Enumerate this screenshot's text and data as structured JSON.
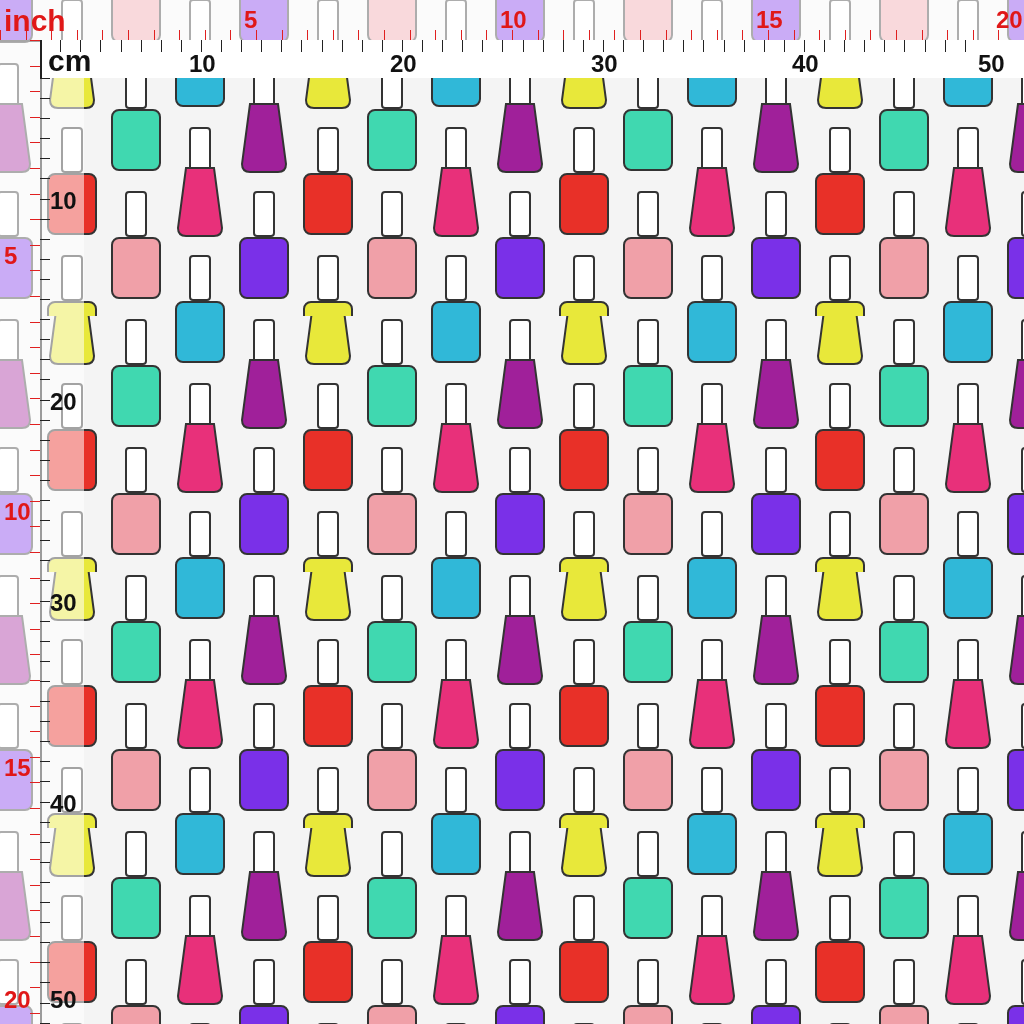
{
  "rulers": {
    "top_inch": {
      "unit": "inch",
      "labels": [
        "5",
        "10",
        "15",
        "20"
      ]
    },
    "top_cm": {
      "unit": "cm",
      "labels": [
        "10",
        "20",
        "30",
        "40",
        "50"
      ]
    },
    "left_cm": {
      "labels": [
        "10",
        "20",
        "30",
        "40",
        "50"
      ]
    },
    "left_inch": {
      "labels": [
        "5",
        "10",
        "15",
        "20"
      ]
    }
  }
}
